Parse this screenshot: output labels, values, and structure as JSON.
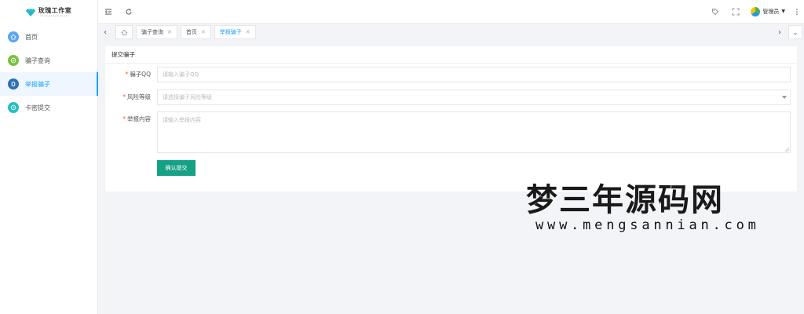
{
  "logo": {
    "title": "玫瑰工作室",
    "subtitle": "rosegongzuoshi"
  },
  "sidebar": {
    "items": [
      {
        "label": "首页",
        "icon": "home-icon",
        "color": "#5aa6f5",
        "active": false
      },
      {
        "label": "骗子查询",
        "icon": "check-icon",
        "color": "#7ac143",
        "active": false
      },
      {
        "label": "举报骗子",
        "icon": "report-icon",
        "color": "#2f6fb6",
        "active": true
      },
      {
        "label": "卡密提交",
        "icon": "clock-icon",
        "color": "#25c0c0",
        "active": false
      }
    ]
  },
  "header": {
    "user_label": "管理员"
  },
  "tabs": [
    {
      "label": "骗子查询",
      "active": false
    },
    {
      "label": "首页",
      "active": false
    },
    {
      "label": "举报骗子",
      "active": true
    }
  ],
  "form": {
    "title": "提交骗子",
    "fields": [
      {
        "label": "骗子QQ",
        "placeholder": "请输入骗子QQ",
        "type": "input"
      },
      {
        "label": "风险等级",
        "placeholder": "请选择骗子风险等级",
        "type": "select"
      },
      {
        "label": "举报内容",
        "placeholder": "请输入举报内容",
        "type": "textarea"
      }
    ],
    "submit_label": "确认提交"
  },
  "watermark": {
    "title": "梦三年源码网",
    "url": "www.mengsannian.com"
  },
  "colors": {
    "accent": "#1e9fff",
    "submit": "#16a085",
    "required": "#ff5722"
  }
}
